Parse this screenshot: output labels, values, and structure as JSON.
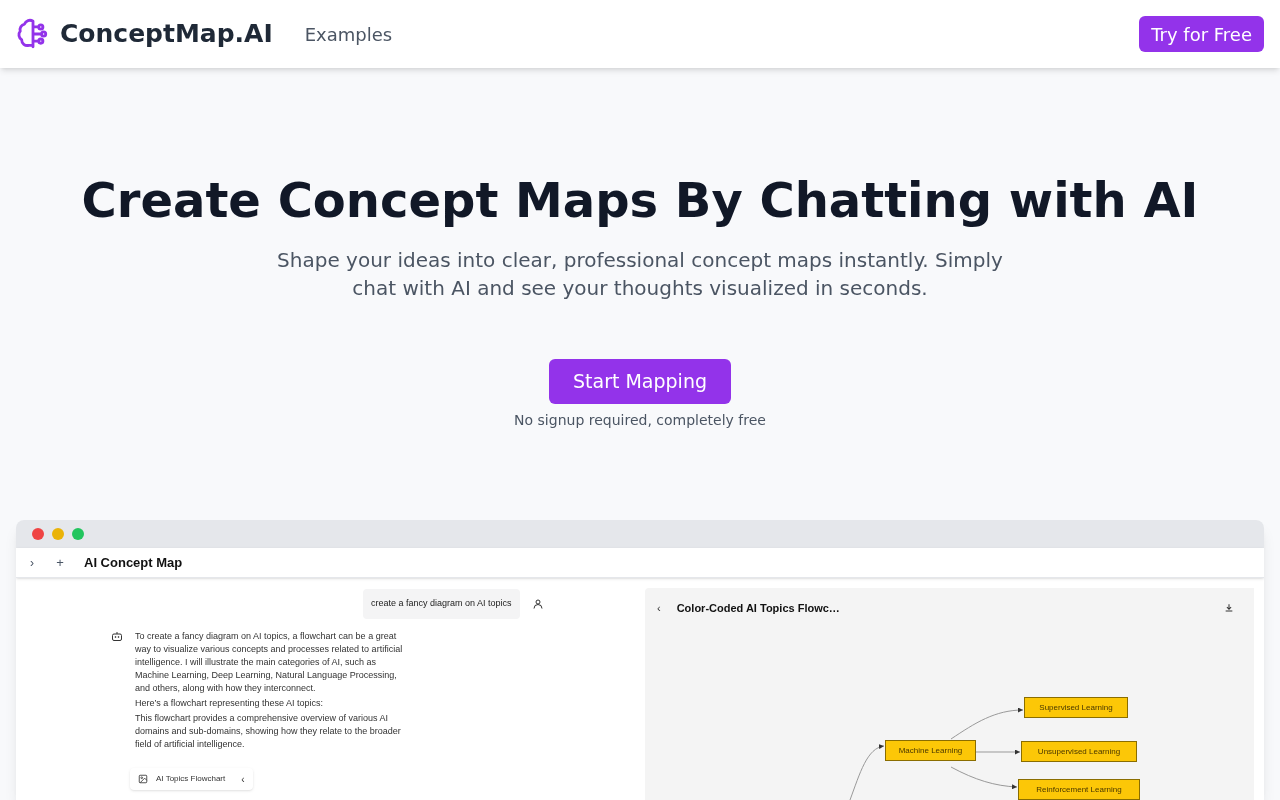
{
  "nav": {
    "brand": "ConceptMap.AI",
    "links": [
      "Examples"
    ],
    "cta": "Try for Free"
  },
  "hero": {
    "title": "Create Concept Maps By Chatting with AI",
    "subtitle": "Shape your ideas into clear, professional concept maps instantly. Simply chat with AI and see your thoughts visualized in seconds.",
    "button": "Start Mapping",
    "note": "No signup required, completely free"
  },
  "preview": {
    "expand_icon": "›",
    "add_icon": "+",
    "app_title": "AI Concept Map",
    "user_message": "create a fancy diagram on AI topics",
    "bot_paragraphs": [
      "To create a fancy diagram on AI topics, a flowchart can be a great way to visualize various concepts and processes related to artificial intelligence. I will illustrate the main categories of AI, such as Machine Learning, Deep Learning, Natural Language Processing, and others, along with how they interconnect.",
      "Here’s a flowchart representing these AI topics:",
      "This flowchart provides a comprehensive overview of various AI domains and sub-domains, showing how they relate to the broader field of artificial intelligence."
    ],
    "attachment": {
      "label": "AI Topics Flowchart",
      "caret": "‹"
    },
    "diagram": {
      "back": "‹",
      "title": "Color-Coded AI Topics Flowc…",
      "nodes": [
        {
          "label": "Supervised Learning"
        },
        {
          "label": "Machine Learning"
        },
        {
          "label": "Unsupervised Learning"
        },
        {
          "label": "Reinforcement Learning"
        }
      ]
    }
  }
}
